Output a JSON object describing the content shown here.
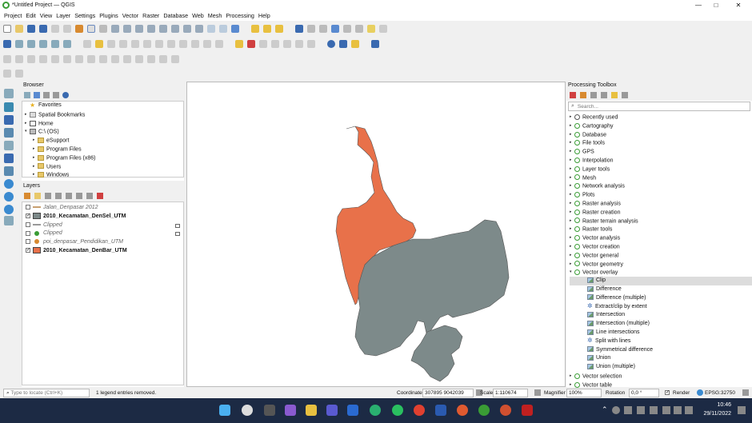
{
  "window": {
    "title": "*Untitled Project — QGIS",
    "min": "—",
    "max": "□",
    "close": "✕"
  },
  "menu": [
    "Project",
    "Edit",
    "View",
    "Layer",
    "Settings",
    "Plugins",
    "Vector",
    "Raster",
    "Database",
    "Web",
    "Mesh",
    "Processing",
    "Help"
  ],
  "browser": {
    "title": "Browser",
    "items": [
      {
        "label": "Favorites",
        "indent": 0,
        "icon": "star-icon",
        "expand": ""
      },
      {
        "label": "Spatial Bookmarks",
        "indent": 0,
        "icon": "bookmark-icon",
        "expand": "▸"
      },
      {
        "label": "Home",
        "indent": 0,
        "icon": "home-icon",
        "expand": "▸"
      },
      {
        "label": "C:\\ (OS)",
        "indent": 0,
        "icon": "drive-icon",
        "expand": "▾"
      },
      {
        "label": "eSupport",
        "indent": 1,
        "icon": "folder-icon",
        "expand": "▸"
      },
      {
        "label": "Program Files",
        "indent": 1,
        "icon": "folder-icon",
        "expand": "▸"
      },
      {
        "label": "Program Files (x86)",
        "indent": 1,
        "icon": "folder-icon",
        "expand": "▸"
      },
      {
        "label": "Users",
        "indent": 1,
        "icon": "folder-icon",
        "expand": "▸"
      },
      {
        "label": "Windows",
        "indent": 1,
        "icon": "folder-icon",
        "expand": "▸"
      }
    ]
  },
  "layers": {
    "title": "Layers",
    "items": [
      {
        "label": "Jalan_Denpasar 2012",
        "checked": false,
        "style": "italic",
        "symbol": "line",
        "color": "#c8a070"
      },
      {
        "label": "2010_Kecamatan_DenSel_UTM",
        "checked": true,
        "style": "bold",
        "symbol": "fill",
        "color": "#7d8a8a"
      },
      {
        "label": "Clipped",
        "checked": false,
        "style": "italic",
        "symbol": "line",
        "color": "#999999"
      },
      {
        "label": "Clipped",
        "checked": false,
        "style": "italic",
        "symbol": "point",
        "color": "#3a9c35"
      },
      {
        "label": "poi_denpasar_Pendidikan_UTM",
        "checked": false,
        "style": "italic",
        "symbol": "point",
        "color": "#d88a30"
      },
      {
        "label": "2010_Kecamatan_DenBar_UTM",
        "checked": true,
        "style": "bold",
        "symbol": "fill",
        "color": "#e8714a"
      }
    ]
  },
  "toolbox": {
    "title": "Processing Toolbox",
    "search_placeholder": "Search...",
    "items": [
      {
        "label": "Recently used",
        "indent": 0,
        "expand": "▸",
        "icon": "clock-icon"
      },
      {
        "label": "Cartography",
        "indent": 0,
        "expand": "▸",
        "icon": "q-icon"
      },
      {
        "label": "Database",
        "indent": 0,
        "expand": "▸",
        "icon": "q-icon"
      },
      {
        "label": "File tools",
        "indent": 0,
        "expand": "▸",
        "icon": "q-icon"
      },
      {
        "label": "GPS",
        "indent": 0,
        "expand": "▸",
        "icon": "q-icon"
      },
      {
        "label": "Interpolation",
        "indent": 0,
        "expand": "▸",
        "icon": "q-icon"
      },
      {
        "label": "Layer tools",
        "indent": 0,
        "expand": "▸",
        "icon": "q-icon"
      },
      {
        "label": "Mesh",
        "indent": 0,
        "expand": "▸",
        "icon": "q-icon"
      },
      {
        "label": "Network analysis",
        "indent": 0,
        "expand": "▸",
        "icon": "q-icon"
      },
      {
        "label": "Plots",
        "indent": 0,
        "expand": "▸",
        "icon": "q-icon"
      },
      {
        "label": "Raster analysis",
        "indent": 0,
        "expand": "▸",
        "icon": "q-icon"
      },
      {
        "label": "Raster creation",
        "indent": 0,
        "expand": "▸",
        "icon": "q-icon"
      },
      {
        "label": "Raster terrain analysis",
        "indent": 0,
        "expand": "▸",
        "icon": "q-icon"
      },
      {
        "label": "Raster tools",
        "indent": 0,
        "expand": "▸",
        "icon": "q-icon"
      },
      {
        "label": "Vector analysis",
        "indent": 0,
        "expand": "▸",
        "icon": "q-icon"
      },
      {
        "label": "Vector creation",
        "indent": 0,
        "expand": "▸",
        "icon": "q-icon"
      },
      {
        "label": "Vector general",
        "indent": 0,
        "expand": "▸",
        "icon": "q-icon"
      },
      {
        "label": "Vector geometry",
        "indent": 0,
        "expand": "▸",
        "icon": "q-icon"
      },
      {
        "label": "Vector overlay",
        "indent": 0,
        "expand": "▾",
        "icon": "q-icon"
      },
      {
        "label": "Clip",
        "indent": 1,
        "expand": "",
        "icon": "tool-icon",
        "selected": true
      },
      {
        "label": "Difference",
        "indent": 1,
        "expand": "",
        "icon": "tool-icon"
      },
      {
        "label": "Difference (multiple)",
        "indent": 1,
        "expand": "",
        "icon": "tool-icon"
      },
      {
        "label": "Extract/clip by extent",
        "indent": 1,
        "expand": "",
        "icon": "gear-icon"
      },
      {
        "label": "Intersection",
        "indent": 1,
        "expand": "",
        "icon": "tool-icon"
      },
      {
        "label": "Intersection (multiple)",
        "indent": 1,
        "expand": "",
        "icon": "tool-icon"
      },
      {
        "label": "Line intersections",
        "indent": 1,
        "expand": "",
        "icon": "tool-icon"
      },
      {
        "label": "Split with lines",
        "indent": 1,
        "expand": "",
        "icon": "gear-icon"
      },
      {
        "label": "Symmetrical difference",
        "indent": 1,
        "expand": "",
        "icon": "tool-icon"
      },
      {
        "label": "Union",
        "indent": 1,
        "expand": "",
        "icon": "tool-icon"
      },
      {
        "label": "Union (multiple)",
        "indent": 1,
        "expand": "",
        "icon": "tool-icon"
      },
      {
        "label": "Vector selection",
        "indent": 0,
        "expand": "▸",
        "icon": "q-icon"
      },
      {
        "label": "Vector table",
        "indent": 0,
        "expand": "▸",
        "icon": "q-icon"
      }
    ]
  },
  "status": {
    "locate_placeholder": "Type to locate (Ctrl+K)",
    "message": "1 legend entries removed.",
    "coordinate_label": "Coordinate",
    "coordinate": "307895 9042039",
    "scale_label": "Scale",
    "scale": "1:110674",
    "magnifier_label": "Magnifier",
    "magnifier": "100%",
    "rotation_label": "Rotation",
    "rotation": "0,0 °",
    "render_label": "Render",
    "crs": "EPSG:32750"
  },
  "clock": {
    "time": "10:46",
    "date": "29/11/2022"
  },
  "colors": {
    "denbar": "#e8714a",
    "densel": "#7d8a8a"
  }
}
